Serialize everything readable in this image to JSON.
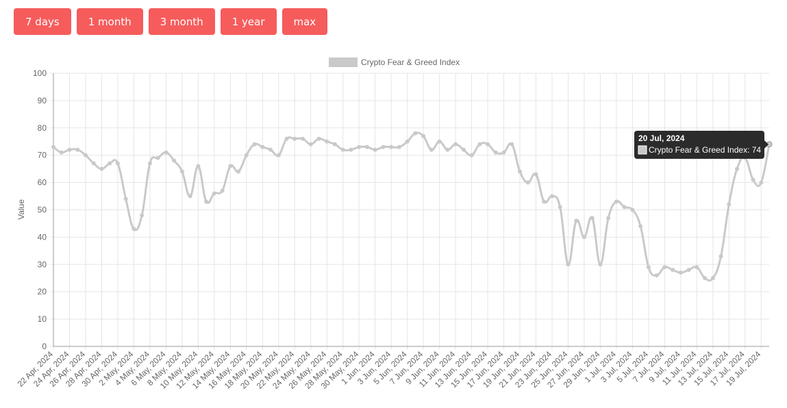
{
  "controls": {
    "range_buttons": [
      {
        "label": "7 days"
      },
      {
        "label": "1 month"
      },
      {
        "label": "3 month"
      },
      {
        "label": "1 year"
      },
      {
        "label": "max"
      }
    ]
  },
  "colors": {
    "button_bg": "#f65c5c",
    "line": "#c9c9c9",
    "grid": "#e5e5e5",
    "axis": "#999999",
    "tooltip_bg": "#2b2b2b"
  },
  "tooltip": {
    "title": "20 Jul, 2024",
    "label": "Crypto Fear & Greed Index: 74",
    "index": 89
  },
  "chart_data": {
    "type": "line",
    "title": "",
    "legend": {
      "entries": [
        "Crypto Fear & Greed Index"
      ],
      "position": "top"
    },
    "xlabel": "",
    "ylabel": "Value",
    "ylim": [
      0,
      100
    ],
    "yticks": [
      0,
      10,
      20,
      30,
      40,
      50,
      60,
      70,
      80,
      90,
      100
    ],
    "grid": true,
    "x": [
      "22 Apr, 2024",
      "23 Apr, 2024",
      "24 Apr, 2024",
      "25 Apr, 2024",
      "26 Apr, 2024",
      "27 Apr, 2024",
      "28 Apr, 2024",
      "29 Apr, 2024",
      "30 Apr, 2024",
      "1 May, 2024",
      "2 May, 2024",
      "3 May, 2024",
      "4 May, 2024",
      "5 May, 2024",
      "6 May, 2024",
      "7 May, 2024",
      "8 May, 2024",
      "9 May, 2024",
      "10 May, 2024",
      "11 May, 2024",
      "12 May, 2024",
      "13 May, 2024",
      "14 May, 2024",
      "15 May, 2024",
      "16 May, 2024",
      "17 May, 2024",
      "18 May, 2024",
      "19 May, 2024",
      "20 May, 2024",
      "21 May, 2024",
      "22 May, 2024",
      "23 May, 2024",
      "24 May, 2024",
      "25 May, 2024",
      "26 May, 2024",
      "27 May, 2024",
      "28 May, 2024",
      "29 May, 2024",
      "30 May, 2024",
      "31 May, 2024",
      "1 Jun, 2024",
      "2 Jun, 2024",
      "3 Jun, 2024",
      "4 Jun, 2024",
      "5 Jun, 2024",
      "6 Jun, 2024",
      "7 Jun, 2024",
      "8 Jun, 2024",
      "9 Jun, 2024",
      "10 Jun, 2024",
      "11 Jun, 2024",
      "12 Jun, 2024",
      "13 Jun, 2024",
      "14 Jun, 2024",
      "15 Jun, 2024",
      "16 Jun, 2024",
      "17 Jun, 2024",
      "18 Jun, 2024",
      "19 Jun, 2024",
      "20 Jun, 2024",
      "21 Jun, 2024",
      "22 Jun, 2024",
      "23 Jun, 2024",
      "24 Jun, 2024",
      "25 Jun, 2024",
      "26 Jun, 2024",
      "27 Jun, 2024",
      "28 Jun, 2024",
      "29 Jun, 2024",
      "30 Jun, 2024",
      "1 Jul, 2024",
      "2 Jul, 2024",
      "3 Jul, 2024",
      "4 Jul, 2024",
      "5 Jul, 2024",
      "6 Jul, 2024",
      "7 Jul, 2024",
      "8 Jul, 2024",
      "9 Jul, 2024",
      "10 Jul, 2024",
      "11 Jul, 2024",
      "12 Jul, 2024",
      "13 Jul, 2024",
      "14 Jul, 2024",
      "15 Jul, 2024",
      "16 Jul, 2024",
      "17 Jul, 2024",
      "18 Jul, 2024",
      "19 Jul, 2024",
      "20 Jul, 2024"
    ],
    "series": [
      {
        "name": "Crypto Fear & Greed Index",
        "values": [
          73,
          71,
          72,
          72,
          70,
          67,
          65,
          67,
          67,
          54,
          43,
          48,
          67,
          69,
          71,
          68,
          64,
          55,
          66,
          53,
          56,
          57,
          66,
          64,
          70,
          74,
          73,
          72,
          70,
          76,
          76,
          76,
          74,
          76,
          75,
          74,
          72,
          72,
          73,
          73,
          72,
          73,
          73,
          73,
          75,
          78,
          77,
          72,
          75,
          72,
          74,
          72,
          70,
          74,
          74,
          71,
          71,
          74,
          64,
          60,
          63,
          53,
          55,
          51,
          30,
          46,
          40,
          47,
          30,
          47,
          53,
          51,
          50,
          44,
          29,
          26,
          29,
          28,
          27,
          28,
          29,
          25,
          25,
          33,
          52,
          65,
          69,
          61,
          60,
          74
        ]
      }
    ]
  }
}
